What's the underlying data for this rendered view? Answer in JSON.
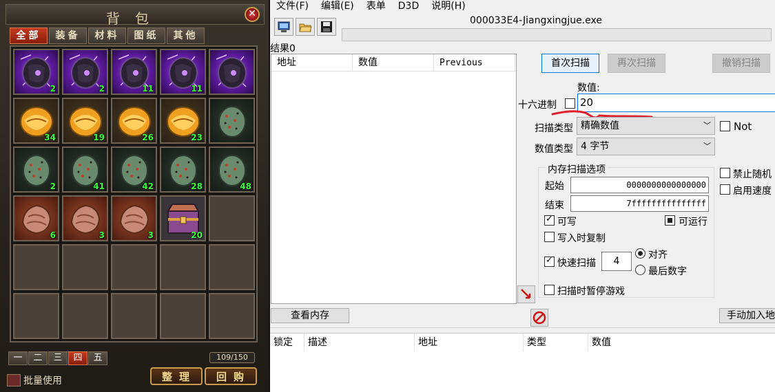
{
  "game": {
    "title": "背包",
    "close_symbol": "✕",
    "tabs": [
      {
        "label": "全部",
        "active": true
      },
      {
        "label": "装备",
        "active": false
      },
      {
        "label": "材料",
        "active": false
      },
      {
        "label": "图纸",
        "active": false
      },
      {
        "label": "其他",
        "active": false
      }
    ],
    "slots": [
      {
        "kind": "purple-stone",
        "count": "2"
      },
      {
        "kind": "purple-stone",
        "count": "2"
      },
      {
        "kind": "purple-stone",
        "count": "11"
      },
      {
        "kind": "purple-stone",
        "count": "11"
      },
      {
        "kind": "purple-stone",
        "count": ""
      },
      {
        "kind": "gold-stone",
        "count": "34"
      },
      {
        "kind": "gold-stone",
        "count": "19"
      },
      {
        "kind": "gold-stone",
        "count": "26"
      },
      {
        "kind": "gold-stone",
        "count": "23"
      },
      {
        "kind": "green-stone",
        "count": ""
      },
      {
        "kind": "green-stone",
        "count": "2"
      },
      {
        "kind": "green-stone",
        "count": "41"
      },
      {
        "kind": "green-stone",
        "count": "42"
      },
      {
        "kind": "green-stone",
        "count": "28"
      },
      {
        "kind": "green-stone",
        "count": "48"
      },
      {
        "kind": "red-stone",
        "count": "6"
      },
      {
        "kind": "red-stone",
        "count": "3"
      },
      {
        "kind": "red-stone",
        "count": "3"
      },
      {
        "kind": "treasure-chest",
        "count": "20"
      },
      {
        "kind": "empty",
        "count": ""
      },
      {
        "kind": "empty",
        "count": ""
      },
      {
        "kind": "empty",
        "count": ""
      },
      {
        "kind": "empty",
        "count": ""
      },
      {
        "kind": "empty",
        "count": ""
      },
      {
        "kind": "empty",
        "count": ""
      },
      {
        "kind": "empty",
        "count": ""
      },
      {
        "kind": "empty",
        "count": ""
      },
      {
        "kind": "empty",
        "count": ""
      },
      {
        "kind": "empty",
        "count": ""
      },
      {
        "kind": "empty",
        "count": ""
      }
    ],
    "pages": [
      {
        "label": "一",
        "active": false
      },
      {
        "label": "二",
        "active": false
      },
      {
        "label": "三",
        "active": false
      },
      {
        "label": "四",
        "active": true
      },
      {
        "label": "五",
        "active": false
      }
    ],
    "capacity": "109/150",
    "batch_use_label": "批量使用",
    "sort_button": "整理",
    "buyback_button": "回购"
  },
  "ce": {
    "menu": [
      "文件(F)",
      "编辑(E)",
      "表单",
      "D3D",
      "说明(H)"
    ],
    "process_title": "000033E4-Jiangxingjue.exe",
    "results_label": "结果0",
    "results_columns": [
      "地址",
      "数值",
      "Previous"
    ],
    "first_scan": "首次扫描",
    "next_scan": "再次扫描",
    "undo_scan": "撤销扫描",
    "value_label": "数值:",
    "hex_label": "十六进制",
    "value": "20",
    "scan_type_label": "扫描类型",
    "scan_type_value": "精确数值",
    "value_type_label": "数值类型",
    "value_type_value": "4 字节",
    "not_label": "Not",
    "mem_options_label": "内存扫描选项",
    "start_label": "起始",
    "start_value": "0000000000000000",
    "end_label": "结束",
    "end_value": "7fffffffffffffff",
    "writable_label": "可写",
    "executable_label": "可运行",
    "copy_on_write_label": "写入时复制",
    "fast_scan_label": "快速扫描",
    "fast_scan_value": "4",
    "align_label": "对齐",
    "last_digits_label": "最后数字",
    "pause_label": "扫描时暂停游戏",
    "disable_random_label": "禁止随机",
    "enable_speed_label": "启用速度",
    "view_memory": "查看内存",
    "manual_add": "手动加入地",
    "addr_columns": [
      "锁定",
      "描述",
      "地址",
      "类型",
      "数值"
    ],
    "colors": {
      "accent": "#0078d7",
      "annotation": "#e0202a",
      "count_green": "#3cff3c"
    }
  }
}
